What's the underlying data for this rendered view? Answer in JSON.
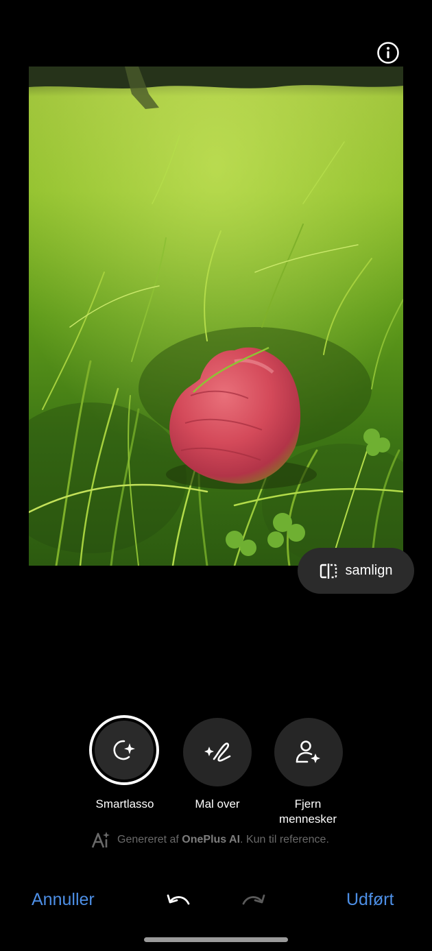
{
  "icons": {
    "info": "info-icon",
    "compare": "compare-split-icon",
    "smartlasso": "lasso-sparkle-icon",
    "mal_over": "brush-sparkle-icon",
    "fjern": "person-sparkle-icon",
    "ai": "ai-sparkle-icon",
    "undo": "undo-icon",
    "redo": "redo-icon"
  },
  "colors": {
    "accent": "#4d8fe6",
    "tool_bg": "#262626",
    "compare_bg": "#2b2b2b"
  },
  "compare": {
    "label": "samlign"
  },
  "tools": [
    {
      "label": "Smartlasso",
      "selected": true
    },
    {
      "label": "Mal over",
      "selected": false
    },
    {
      "label_line1": "Fjern",
      "label_line2": "mennesker",
      "selected": false
    }
  ],
  "ai_note": {
    "prefix": "Genereret af ",
    "brand": "OnePlus AI",
    "suffix": ". Kun til reference."
  },
  "bottom_bar": {
    "cancel": "Annuller",
    "done": "Udført"
  }
}
